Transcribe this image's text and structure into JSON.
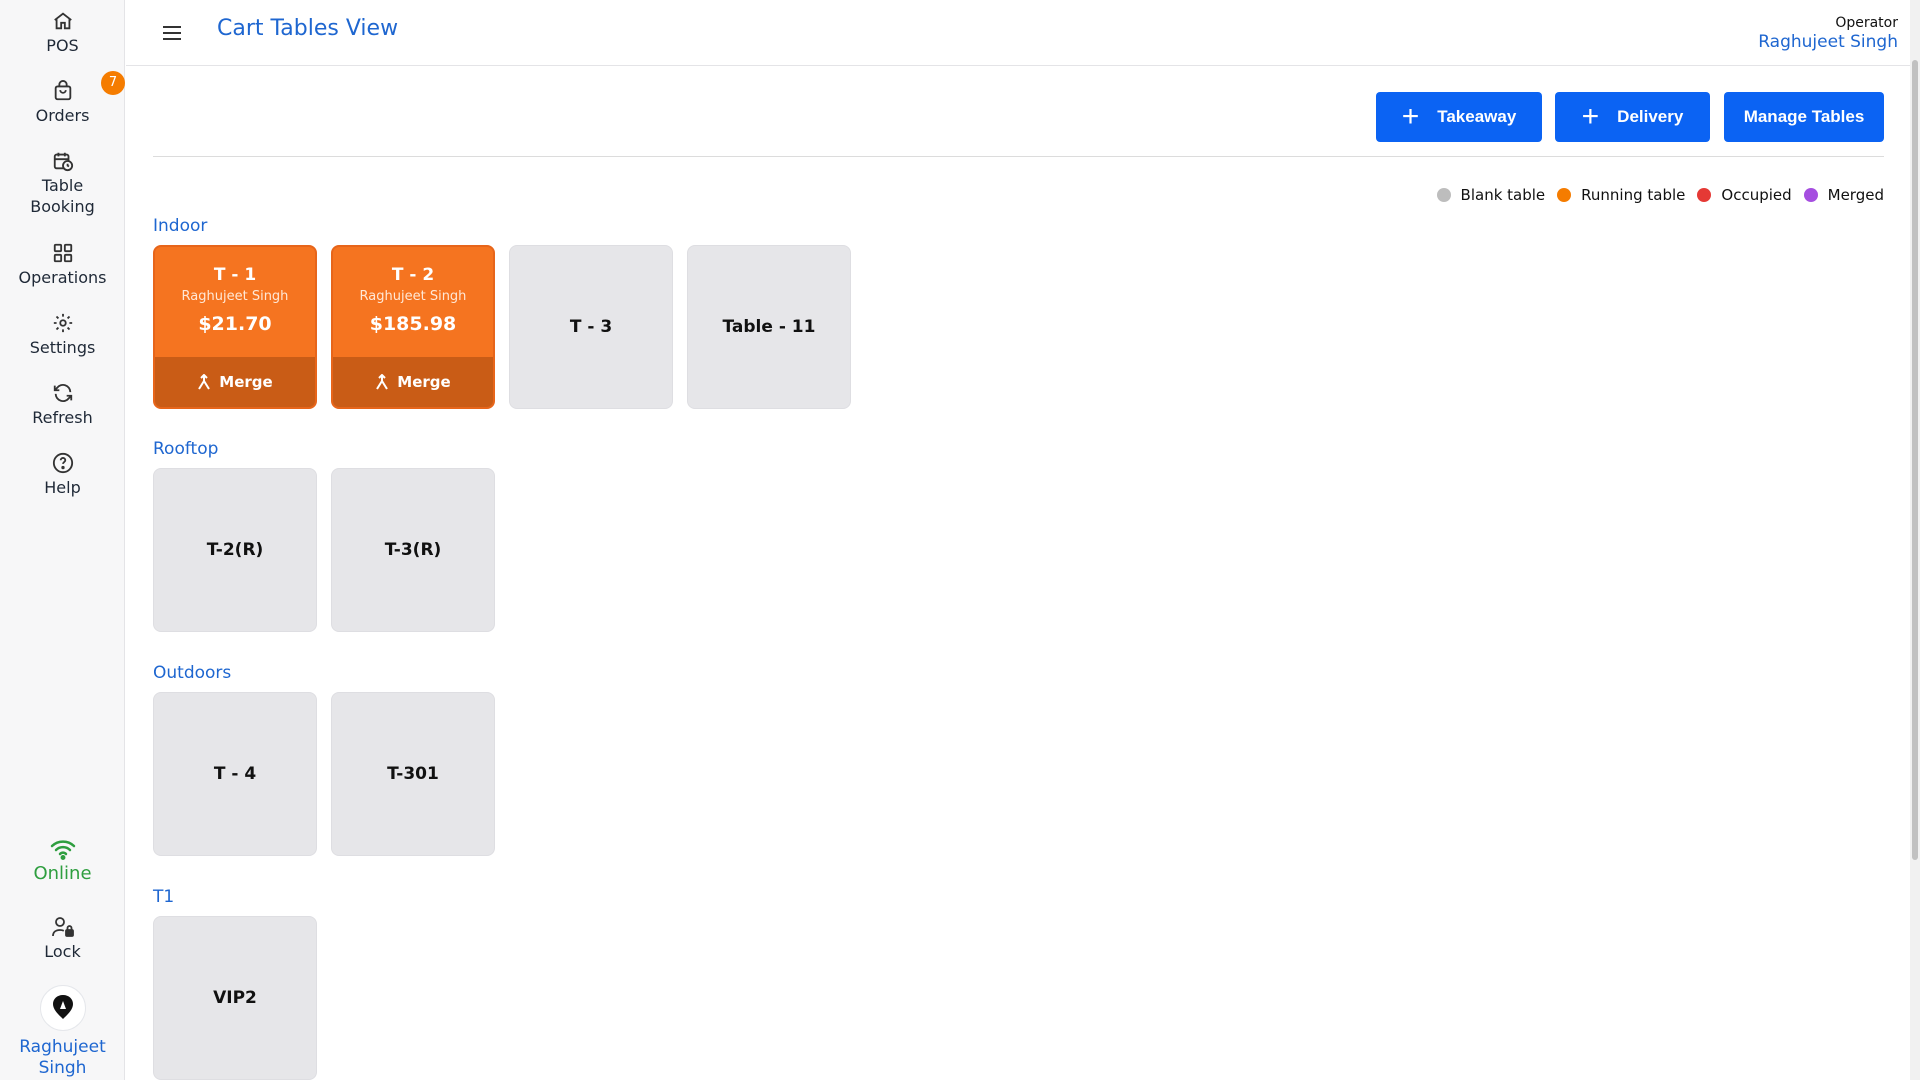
{
  "sidebar": {
    "items": [
      {
        "label": "POS",
        "icon": "home-icon"
      },
      {
        "label": "Orders",
        "icon": "shopping-bag-icon",
        "badge": "7"
      },
      {
        "label": "Table Booking",
        "icon": "calendar-clock-icon"
      },
      {
        "label": "Operations",
        "icon": "grid-icon"
      },
      {
        "label": "Settings",
        "icon": "gear-icon"
      },
      {
        "label": "Refresh",
        "icon": "refresh-icon"
      },
      {
        "label": "Help",
        "icon": "help-icon"
      }
    ],
    "status_label": "Online",
    "lock_label": "Lock",
    "user_name": "Raghujeet Singh"
  },
  "header": {
    "title": "Cart Tables View",
    "operator_label": "Operator",
    "operator_name": "Raghujeet Singh"
  },
  "actions": {
    "takeaway_label": "Takeaway",
    "delivery_label": "Delivery",
    "manage_tables_label": "Manage Tables"
  },
  "legend": {
    "items": [
      {
        "label": "Blank table",
        "color": "#bdbdbd"
      },
      {
        "label": "Running table",
        "color": "#f57c00"
      },
      {
        "label": "Occupied",
        "color": "#e53935"
      },
      {
        "label": "Merged",
        "color": "#a54ee0"
      }
    ]
  },
  "sections": [
    {
      "title": "Indoor",
      "tables": [
        {
          "name": "T - 1",
          "status": "running",
          "operator": "Raghujeet Singh",
          "amount": "$21.70",
          "action": "Merge"
        },
        {
          "name": "T - 2",
          "status": "running",
          "operator": "Raghujeet Singh",
          "amount": "$185.98",
          "action": "Merge"
        },
        {
          "name": "T - 3",
          "status": "blank"
        },
        {
          "name": "Table - 11",
          "status": "blank"
        }
      ]
    },
    {
      "title": "Rooftop",
      "tables": [
        {
          "name": "T-2(R)",
          "status": "blank"
        },
        {
          "name": "T-3(R)",
          "status": "blank"
        }
      ]
    },
    {
      "title": "Outdoors",
      "tables": [
        {
          "name": "T - 4",
          "status": "blank"
        },
        {
          "name": "T-301",
          "status": "blank"
        }
      ]
    },
    {
      "title": "T1",
      "tables": [
        {
          "name": "VIP2",
          "status": "blank"
        }
      ]
    }
  ],
  "colors": {
    "accent": "#0b63f3",
    "link": "#1e66d0",
    "running": "#f57420",
    "running_dark": "#c95c16",
    "blank": "#e6e6e9",
    "online": "#2e9e3f"
  }
}
